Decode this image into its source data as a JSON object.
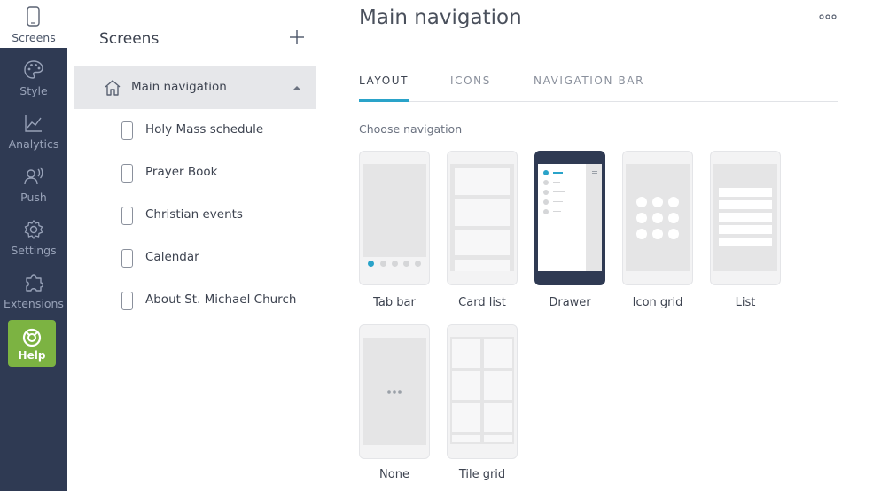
{
  "rail": {
    "items": [
      {
        "label": "Screens",
        "icon": "phone-icon",
        "active": true
      },
      {
        "label": "Style",
        "icon": "palette-icon"
      },
      {
        "label": "Analytics",
        "icon": "chart-icon"
      },
      {
        "label": "Push",
        "icon": "push-icon"
      },
      {
        "label": "Settings",
        "icon": "gear-icon"
      },
      {
        "label": "Extensions",
        "icon": "puzzle-icon"
      }
    ],
    "help": {
      "label": "Help",
      "icon": "lifebuoy-icon",
      "color": "#7cb342"
    }
  },
  "screens_panel": {
    "title": "Screens",
    "items": [
      {
        "label": "Main navigation",
        "icon": "home-icon",
        "active": true
      },
      {
        "label": "Holy Mass schedule",
        "icon": "phone-icon"
      },
      {
        "label": "Prayer Book",
        "icon": "phone-icon"
      },
      {
        "label": "Christian events",
        "icon": "phone-icon"
      },
      {
        "label": "Calendar",
        "icon": "phone-icon"
      },
      {
        "label": "About St. Michael Church",
        "icon": "phone-icon"
      }
    ]
  },
  "main": {
    "title": "Main navigation",
    "tabs": [
      {
        "label": "LAYOUT",
        "active": true
      },
      {
        "label": "ICONS"
      },
      {
        "label": "NAVIGATION BAR"
      }
    ],
    "section_label": "Choose navigation",
    "layouts": [
      {
        "label": "Tab bar"
      },
      {
        "label": "Card list"
      },
      {
        "label": "Drawer",
        "selected": true
      },
      {
        "label": "Icon grid"
      },
      {
        "label": "List"
      },
      {
        "label": "None"
      },
      {
        "label": "Tile grid"
      }
    ]
  },
  "colors": {
    "rail_bg": "#2f3a53",
    "accent": "#2aa3c9",
    "help_green": "#7cb342"
  }
}
